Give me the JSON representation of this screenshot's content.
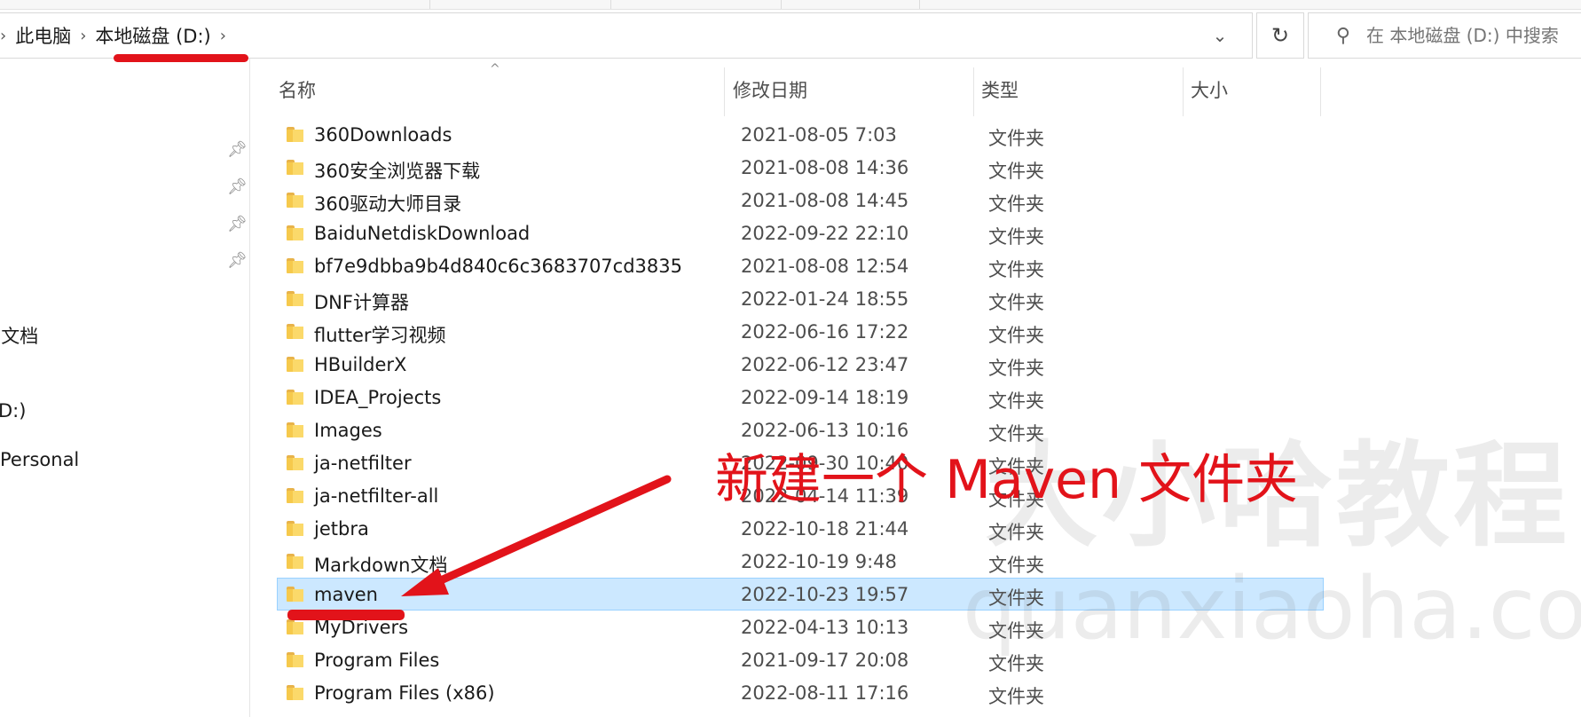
{
  "breadcrumb": {
    "items": [
      "此电脑",
      "本地磁盘 (D:)"
    ]
  },
  "search": {
    "placeholder": "在 本地磁盘 (D:) 中搜索"
  },
  "columns": {
    "name": "名称",
    "date": "修改日期",
    "type": "类型",
    "size": "大小"
  },
  "nav": {
    "items": [
      "n文档",
      "D:)",
      "Personal"
    ]
  },
  "files": [
    {
      "name": "360Downloads",
      "date": "2021-08-05 7:03",
      "type": "文件夹"
    },
    {
      "name": "360安全浏览器下载",
      "date": "2021-08-08 14:36",
      "type": "文件夹"
    },
    {
      "name": "360驱动大师目录",
      "date": "2021-08-08 14:45",
      "type": "文件夹"
    },
    {
      "name": "BaiduNetdiskDownload",
      "date": "2022-09-22 22:10",
      "type": "文件夹"
    },
    {
      "name": "bf7e9dbba9b4d840c6c3683707cd3835",
      "date": "2021-08-08 12:54",
      "type": "文件夹"
    },
    {
      "name": "DNF计算器",
      "date": "2022-01-24 18:55",
      "type": "文件夹"
    },
    {
      "name": "flutter学习视频",
      "date": "2022-06-16 17:22",
      "type": "文件夹"
    },
    {
      "name": "HBuilderX",
      "date": "2022-06-12 23:47",
      "type": "文件夹"
    },
    {
      "name": "IDEA_Projects",
      "date": "2022-09-14 18:19",
      "type": "文件夹"
    },
    {
      "name": "Images",
      "date": "2022-06-13 10:16",
      "type": "文件夹"
    },
    {
      "name": "ja-netfilter",
      "date": "2022-09-30 10:40",
      "type": "文件夹"
    },
    {
      "name": "ja-netfilter-all",
      "date": "2022-04-14 11:39",
      "type": "文件夹"
    },
    {
      "name": "jetbra",
      "date": "2022-10-18 21:44",
      "type": "文件夹"
    },
    {
      "name": "Markdown文档",
      "date": "2022-10-19 9:48",
      "type": "文件夹"
    },
    {
      "name": "maven",
      "date": "2022-10-23 19:57",
      "type": "文件夹",
      "selected": true
    },
    {
      "name": "MyDrivers",
      "date": "2022-04-13 10:13",
      "type": "文件夹"
    },
    {
      "name": "Program Files",
      "date": "2021-09-17 20:08",
      "type": "文件夹"
    },
    {
      "name": "Program Files (x86)",
      "date": "2022-08-11 17:16",
      "type": "文件夹"
    }
  ],
  "annotation": {
    "text": "新建一个 Maven 文件夹",
    "color": "#e2131a"
  },
  "watermark": {
    "cn": "大小哈教程",
    "en": "quanxiaoha.com"
  },
  "colors": {
    "selection_bg": "#cce8ff",
    "selection_border": "#99d1ff",
    "folder": "#f6c94c",
    "annotation_red": "#e2131a"
  },
  "icons": {
    "nav_pins": "pin-icon",
    "folder": "folder-icon",
    "refresh": "refresh-icon",
    "search": "search-icon"
  }
}
